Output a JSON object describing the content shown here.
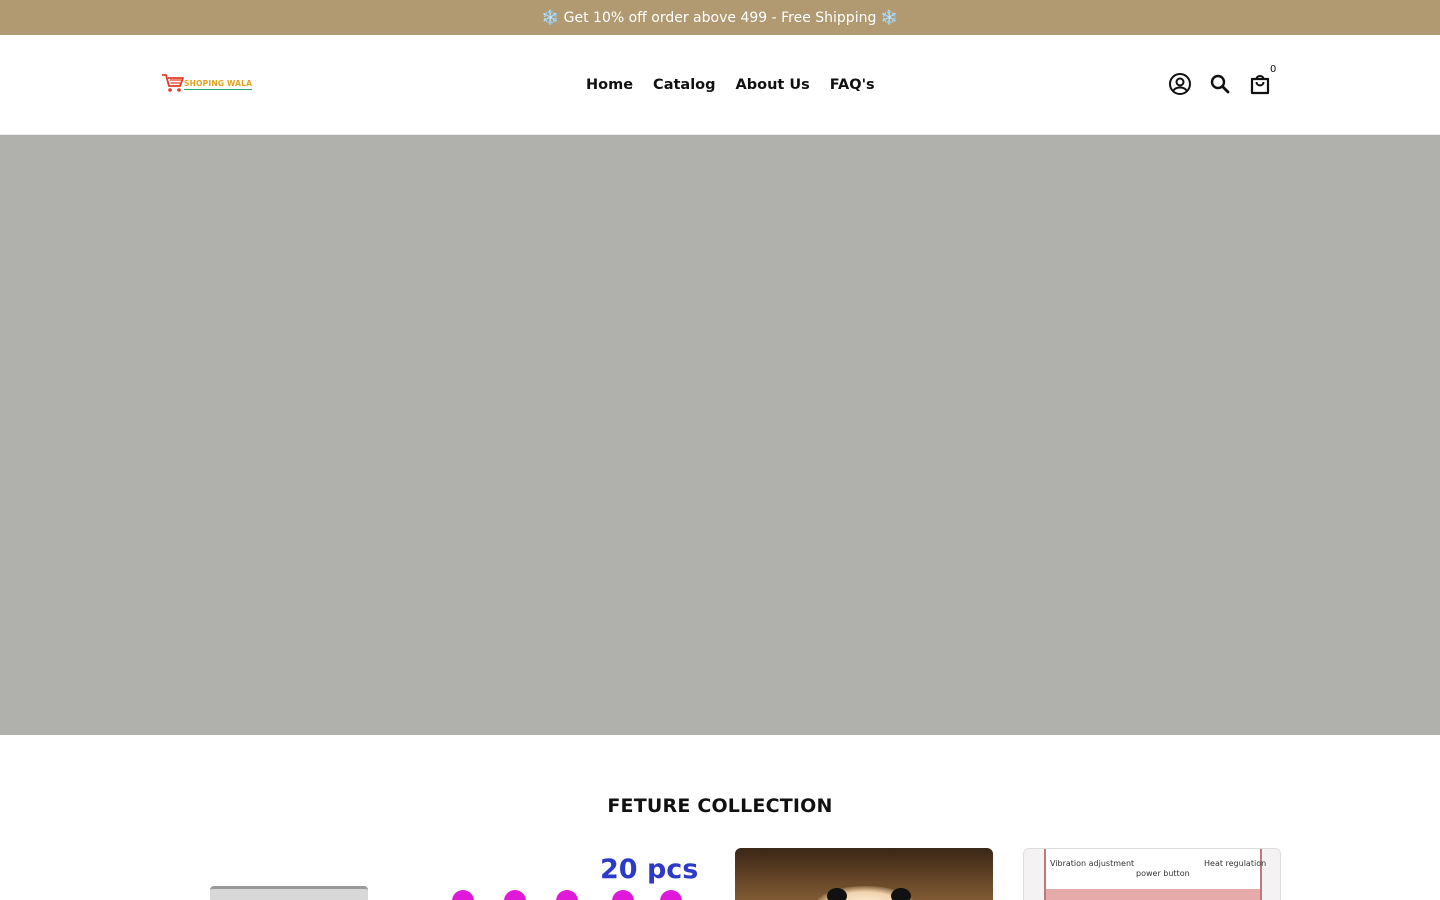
{
  "announcement": {
    "text": "❄️ Get 10% off order above 499 - Free Shipping ❄️"
  },
  "header": {
    "logo": {
      "text": "SHOPING WALA",
      "icon": "shopping-cart-icon"
    },
    "nav": [
      {
        "label": "Home"
      },
      {
        "label": "Catalog"
      },
      {
        "label": "About Us"
      },
      {
        "label": "FAQ's"
      }
    ],
    "icons": {
      "account": "account-icon",
      "search": "search-icon",
      "cart": "shopping-bag-icon"
    },
    "cart_count": "0"
  },
  "section": {
    "title": "FETURE COLLECTION"
  },
  "products": [
    {
      "image_text": ""
    },
    {
      "image_text": "20 pcs"
    },
    {
      "image_text": ""
    },
    {
      "image_labels": {
        "vibration": "Vibration adjustment",
        "power": "power button",
        "heat": "Heat regulation"
      }
    }
  ],
  "colors": {
    "announcement_bg": "#b19a72",
    "hero_bg": "#b0b0ac",
    "accent_text": "#111111"
  }
}
